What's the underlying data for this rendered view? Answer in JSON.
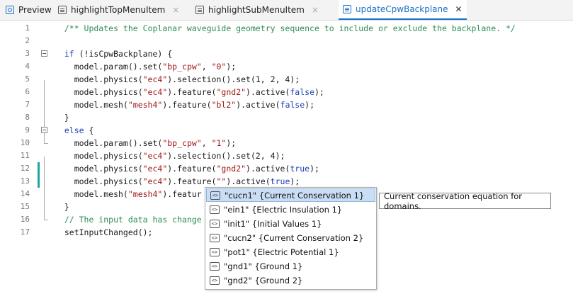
{
  "tabs": [
    {
      "label": "Preview",
      "icon": "preview-icon",
      "closable": false
    },
    {
      "label": "highlightTopMenuItem",
      "icon": "method-document-icon",
      "closable": true
    },
    {
      "label": "highlightSubMenuItem",
      "icon": "method-document-icon",
      "closable": true
    },
    {
      "label": "updateCpwBackplane",
      "icon": "method-document-icon",
      "closable": true,
      "active": true
    }
  ],
  "close_glyph": "×",
  "active_close_glyph": "✕",
  "colors": {
    "accent": "#1a6fc4",
    "change_marker": "#1aa7a0",
    "comment": "#2e8b57",
    "keyword": "#1f3fb5",
    "string": "#a31515",
    "selection": "#c9def4"
  },
  "editor": {
    "lines": [
      {
        "num": "1",
        "text": "  /** Updates the Coplanar waveguide geometry sequence to include or exclude the backplane. */"
      },
      {
        "num": "2",
        "text": ""
      },
      {
        "num": "3",
        "text": "  if (!isCpwBackplane) {"
      },
      {
        "num": "4",
        "text": "    model.param().set(\"bp_cpw\", \"0\");"
      },
      {
        "num": "5",
        "text": "    model.physics(\"ec4\").selection().set(1, 2, 4);"
      },
      {
        "num": "6",
        "text": "    model.physics(\"ec4\").feature(\"gnd2\").active(false);"
      },
      {
        "num": "7",
        "text": "    model.mesh(\"mesh4\").feature(\"bl2\").active(false);"
      },
      {
        "num": "8",
        "text": "  }"
      },
      {
        "num": "9",
        "text": "  else {"
      },
      {
        "num": "10",
        "text": "    model.param().set(\"bp_cpw\", \"1\");"
      },
      {
        "num": "11",
        "text": "    model.physics(\"ec4\").selection().set(2, 4);"
      },
      {
        "num": "12",
        "text": "    model.physics(\"ec4\").feature(\"gnd2\").active(true);"
      },
      {
        "num": "13",
        "text": "    model.physics(\"ec4\").feature(\"\").active(true);"
      },
      {
        "num": "14",
        "text": "    model.mesh(\"mesh4\").featur"
      },
      {
        "num": "15",
        "text": "  }"
      },
      {
        "num": "16",
        "text": "  // The input data has change"
      },
      {
        "num": "17",
        "text": "  setInputChanged();"
      }
    ],
    "changed_lines": [
      "12",
      "13"
    ]
  },
  "autocomplete": {
    "items": [
      {
        "label": "\"cucn1\" {Current Conservation 1}",
        "selected": true
      },
      {
        "label": "\"ein1\" {Electric Insulation 1}"
      },
      {
        "label": "\"init1\" {Initial Values 1}"
      },
      {
        "label": "\"cucn2\" {Current Conservation 2}"
      },
      {
        "label": "\"pot1\" {Electric Potential 1}"
      },
      {
        "label": "\"gnd1\" {Ground 1}"
      },
      {
        "label": "\"gnd2\" {Ground 2}"
      }
    ],
    "item_icon": "feature-tag-icon",
    "item_icon_glyph": "<>",
    "tooltip": "Current conservation equation for domains."
  }
}
